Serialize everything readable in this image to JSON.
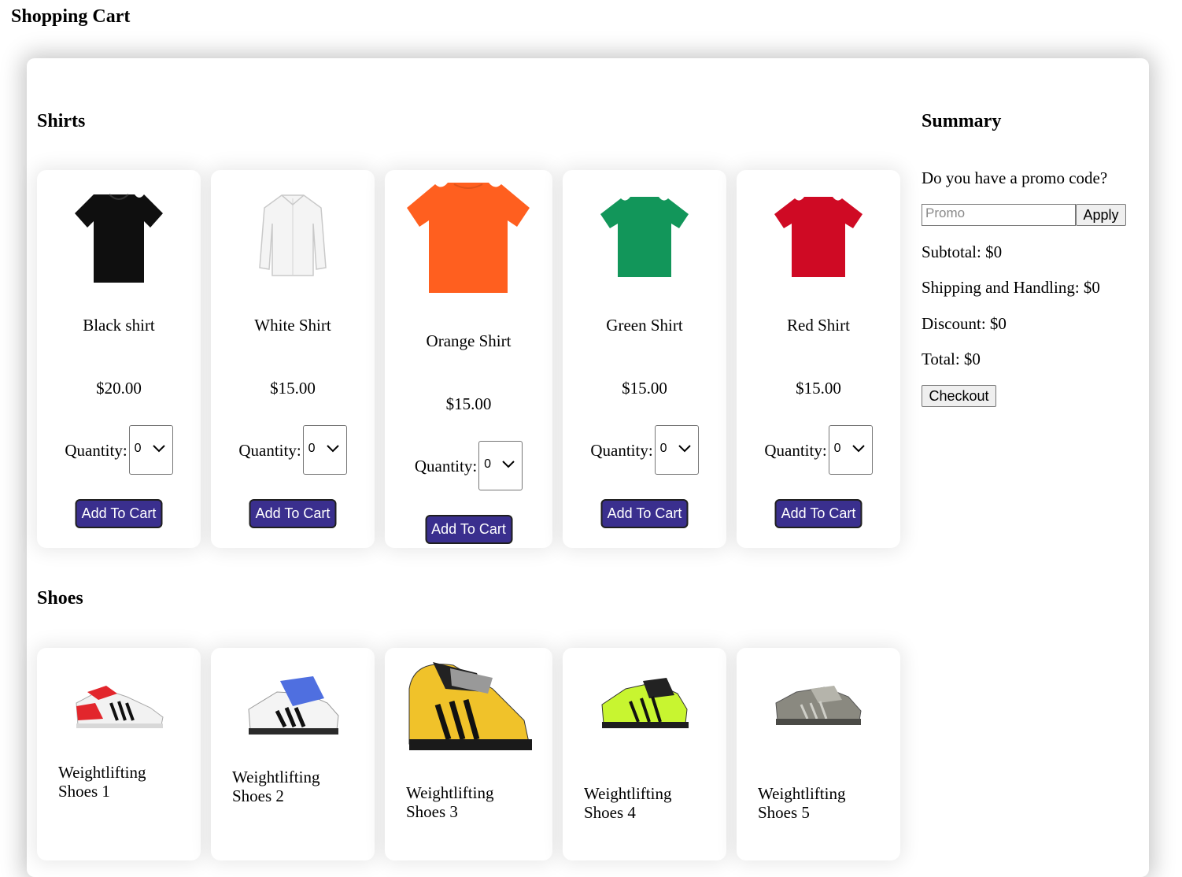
{
  "page": {
    "title": "Shopping Cart"
  },
  "sections": {
    "shirts": {
      "title": "Shirts",
      "products": [
        {
          "name": "Black shirt",
          "price": "$20.00",
          "quantity_label": "Quantity:",
          "quantity": "0",
          "add_label": "Add To Cart",
          "color": "#0f0f0f",
          "icon": "black-shirt-image"
        },
        {
          "name": "White Shirt",
          "price": "$15.00",
          "quantity_label": "Quantity:",
          "quantity": "0",
          "add_label": "Add To Cart",
          "color": "#f4f4f4",
          "icon": "white-shirt-image"
        },
        {
          "name": "Orange Shirt",
          "price": "$15.00",
          "quantity_label": "Quantity:",
          "quantity": "0",
          "add_label": "Add To Cart",
          "color": "#ff5f1f",
          "icon": "orange-shirt-image"
        },
        {
          "name": "Green Shirt",
          "price": "$15.00",
          "quantity_label": "Quantity:",
          "quantity": "0",
          "add_label": "Add To Cart",
          "color": "#12965a",
          "icon": "green-shirt-image"
        },
        {
          "name": "Red Shirt",
          "price": "$15.00",
          "quantity_label": "Quantity:",
          "quantity": "0",
          "add_label": "Add To Cart",
          "color": "#cf0a24",
          "icon": "red-shirt-image"
        }
      ]
    },
    "shoes": {
      "title": "Shoes",
      "products": [
        {
          "name": "Weightlifting Shoes 1",
          "color": "#e2262c",
          "icon": "shoe-1-image"
        },
        {
          "name": "Weightlifting Shoes 2",
          "color": "#4f6fe0",
          "icon": "shoe-2-image"
        },
        {
          "name": "Weightlifting Shoes 3",
          "color": "#f0c22a",
          "icon": "shoe-3-image"
        },
        {
          "name": "Weightlifting Shoes 4",
          "color": "#c8f530",
          "icon": "shoe-4-image"
        },
        {
          "name": "Weightlifting Shoes 5",
          "color": "#8a8980",
          "icon": "shoe-5-image"
        }
      ]
    }
  },
  "summary": {
    "title": "Summary",
    "promo_question": "Do you have a promo code?",
    "promo_placeholder": "Promo",
    "apply_label": "Apply",
    "subtotal": "Subtotal: $0",
    "shipping": "Shipping and Handling: $0",
    "discount": "Discount: $0",
    "total": "Total: $0",
    "checkout_label": "Checkout"
  },
  "theme": {
    "button_color": "#3a2f8e"
  }
}
